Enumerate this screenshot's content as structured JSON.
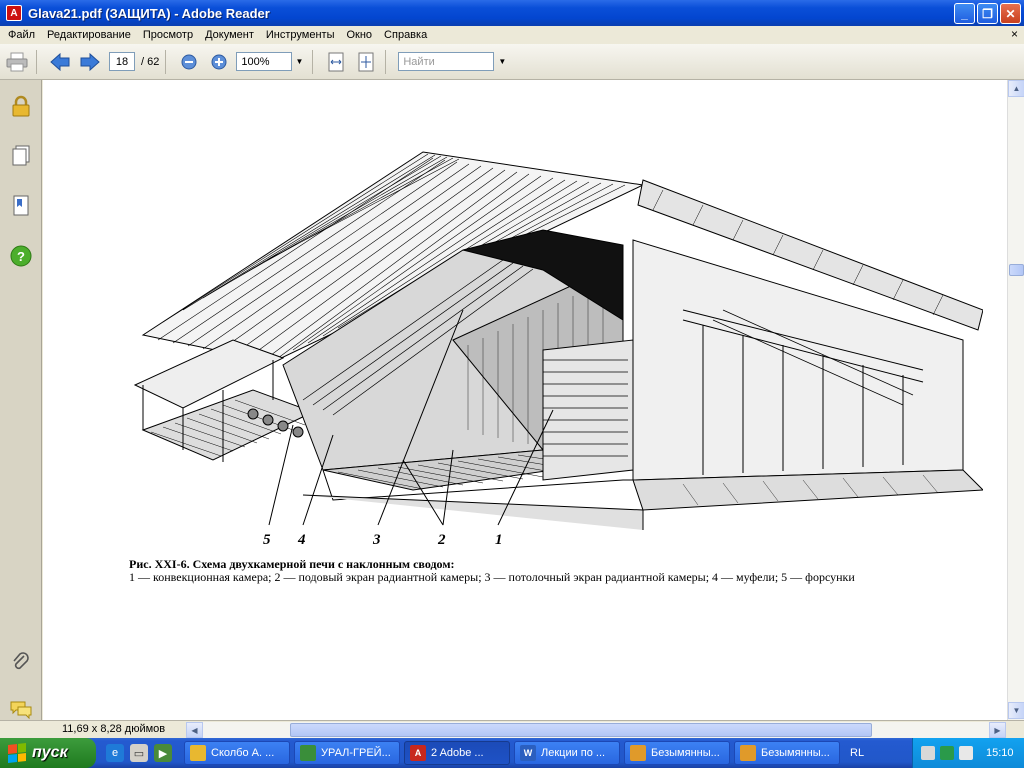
{
  "window": {
    "title": "Glava21.pdf (ЗАЩИТА) - Adobe Reader",
    "controls": {
      "minimize": "_",
      "maximize": "❐",
      "close": "✕"
    }
  },
  "menu": {
    "items": [
      "Файл",
      "Редактирование",
      "Просмотр",
      "Документ",
      "Инструменты",
      "Окно",
      "Справка"
    ],
    "close": "×"
  },
  "toolbar": {
    "current_page": "18",
    "page_total": "/ 62",
    "zoom": "100%",
    "search_placeholder": "Найти"
  },
  "document": {
    "figure_labels": [
      "5",
      "4",
      "3",
      "2",
      "1"
    ],
    "caption_title": "Рис. XXI-6. Схема двухкамерной печи с наклонным сводом:",
    "caption_body": "1 — конвекционная камера; 2 — подовый экран радиантной камеры; 3 — потолочный экран радиантной камеры; 4 — муфели; 5 — форсунки"
  },
  "statusbar": {
    "page_size": "11,69 x 8,28 дюймов"
  },
  "taskbar": {
    "start_label": "пуск",
    "tasks": [
      {
        "label": "Сколбо А. ...",
        "icon": "folder-icon",
        "color": "#e8b830"
      },
      {
        "label": "УРАЛ-ГРЕЙ...",
        "icon": "browser-icon",
        "color": "#3a8e3a"
      },
      {
        "label": "2 Adobe ...",
        "icon": "adobe-icon",
        "color": "#c8281e"
      },
      {
        "label": "Лекции по ...",
        "icon": "word-icon",
        "color": "#2b5fbf"
      },
      {
        "label": "Безымянны...",
        "icon": "paint-icon",
        "color": "#e09a2a"
      },
      {
        "label": "Безымянны...",
        "icon": "paint-icon",
        "color": "#e09a2a"
      }
    ],
    "language": "RL",
    "clock": "15:10"
  }
}
